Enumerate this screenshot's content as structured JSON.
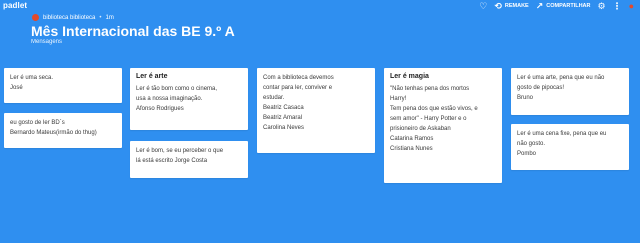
{
  "app": {
    "brand": "padlet"
  },
  "topbar": {
    "heart_icon": "heart-icon",
    "remake_label": "REMAKE",
    "share_label": "COMPARTILHAR",
    "settings_icon": "gear-icon",
    "more_icon": "dots-icon",
    "status_icon": "avatar-icon"
  },
  "header": {
    "author": "biblioteca biblioteca",
    "dot": "•",
    "time": "1m",
    "title": "Mês Internacional das BE 9.º A",
    "subtitle": "Mensagens"
  },
  "columns": [
    {
      "cards": [
        {
          "subject": "",
          "body": "Ler é uma seca.\nJosé"
        },
        {
          "subject": "",
          "body": "eu gosto de ler BD´s\nBernardo Mateus(irmão do thug)"
        }
      ]
    },
    {
      "cards": [
        {
          "subject": "Ler é arte",
          "body": "Ler é tão bom como o cinema,\nusa a nossa imaginação.\nAfonso Rodrigues"
        },
        {
          "subject": "",
          "body": "Ler é bom, se eu perceber o que\nlá está escrito Jorge Costa"
        }
      ]
    },
    {
      "cards": [
        {
          "subject": "",
          "body": "Com a biblioteca devemos\ncontar para ler, conviver e\nestudar.\nBeatriz Casaca\nBeatriz Amaral\nCarolina Neves"
        }
      ]
    },
    {
      "cards": [
        {
          "subject": "Ler é magia",
          "body": "\"Não tenhas pena dos mortos\nHarry!\nTem pena dos que estão vivos, e\nsem amor\" - Harry Potter e o\nprisioneiro de Askaban\nCatarina Ramos\nCristiana Nunes"
        }
      ]
    },
    {
      "cards": [
        {
          "subject": "",
          "body": "Ler é uma arte, pena que eu não\ngosto de pipocas!\nBruno"
        },
        {
          "subject": "",
          "body": "Ler é uma cena fixe, pena que eu\nnão gosto.\nPombo"
        }
      ]
    }
  ],
  "colors": {
    "background": "#2f8ff0",
    "card": "#ffffff",
    "accent": "#e14a2b"
  }
}
